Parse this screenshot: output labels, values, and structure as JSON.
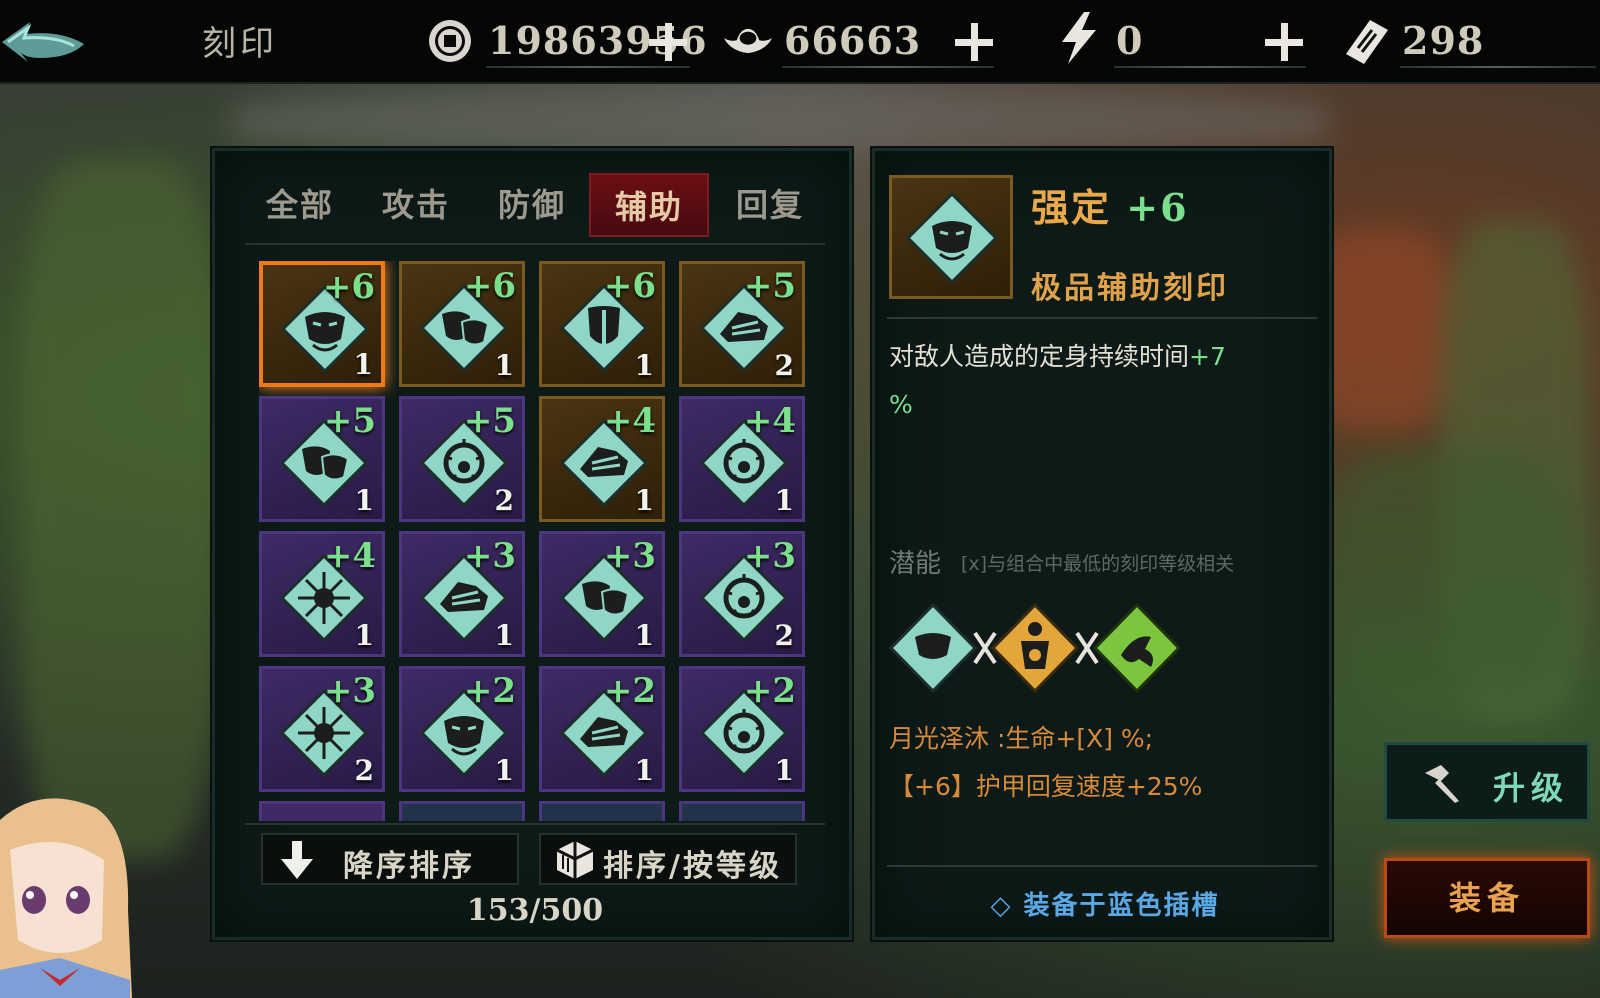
{
  "header": {
    "title": "刻印",
    "currencies": [
      {
        "icon": "copper-coin-icon",
        "value": "19863956"
      },
      {
        "icon": "silver-ingot-icon",
        "value": "66663"
      },
      {
        "icon": "lightning-energy-icon",
        "value": "0"
      },
      {
        "icon": "ticket-icon",
        "value": "298"
      }
    ]
  },
  "tabs": [
    {
      "label": "全部",
      "active": false
    },
    {
      "label": "攻击",
      "active": false
    },
    {
      "label": "防御",
      "active": false
    },
    {
      "label": "辅助",
      "active": true
    },
    {
      "label": "回复",
      "active": false
    }
  ],
  "grid": {
    "items": [
      {
        "level": "+6",
        "count": "1",
        "rarity": "gold",
        "icon": "mask-icon",
        "selected": true
      },
      {
        "level": "+6",
        "count": "1",
        "rarity": "gold",
        "icon": "theater-mask-icon"
      },
      {
        "level": "+6",
        "count": "1",
        "rarity": "gold",
        "icon": "shield-icon"
      },
      {
        "level": "+5",
        "count": "2",
        "rarity": "gold",
        "icon": "boot-icon"
      },
      {
        "level": "+5",
        "count": "1",
        "rarity": "purple",
        "icon": "theater-mask-icon"
      },
      {
        "level": "+5",
        "count": "2",
        "rarity": "purple",
        "icon": "thorn-ring-icon"
      },
      {
        "level": "+4",
        "count": "1",
        "rarity": "gold",
        "icon": "boot-icon"
      },
      {
        "level": "+4",
        "count": "1",
        "rarity": "purple",
        "icon": "thorn-ring-icon"
      },
      {
        "level": "+4",
        "count": "1",
        "rarity": "purple",
        "icon": "spark-icon"
      },
      {
        "level": "+3",
        "count": "1",
        "rarity": "purple",
        "icon": "boot-icon"
      },
      {
        "level": "+3",
        "count": "1",
        "rarity": "purple",
        "icon": "theater-mask-icon"
      },
      {
        "level": "+3",
        "count": "2",
        "rarity": "purple",
        "icon": "thorn-ring-icon"
      },
      {
        "level": "+3",
        "count": "2",
        "rarity": "purple",
        "icon": "spark-icon"
      },
      {
        "level": "+2",
        "count": "1",
        "rarity": "purple",
        "icon": "mask-icon"
      },
      {
        "level": "+2",
        "count": "1",
        "rarity": "purple",
        "icon": "boot-icon"
      },
      {
        "level": "+2",
        "count": "1",
        "rarity": "purple",
        "icon": "thorn-ring-icon"
      }
    ]
  },
  "sort": {
    "order_label": "降序排序",
    "by_label": "排序/按等级"
  },
  "inventory_count": "153/500",
  "detail": {
    "name": "强定",
    "level": "+6",
    "subtitle": "极品辅助刻印",
    "desc_text": "对敌人造成的定身持续时间",
    "desc_value": "+7",
    "desc_unit": "%",
    "potential_label": "潜能",
    "potential_note": "[x]与组合中最低的刻印等级相关",
    "combo_icons": [
      "mask-icon",
      "human-figure-icon",
      "dancer-icon"
    ],
    "bonus_line1": "月光泽沐 :生命+[X] %;",
    "bonus_line2": "【+6】护甲回复速度+25%",
    "equip_slot": "◇ 装备于蓝色插槽"
  },
  "actions": {
    "upgrade_label": "升级",
    "equip_label": "装备"
  },
  "colors": {
    "gold_cell": "#4a3412",
    "purple_cell": "#3f2a66",
    "selected_border": "#f07a1a",
    "level_green": "#7be08c",
    "title_orange": "#e9a84a",
    "equip_blue": "#5aa8e6",
    "active_tab": "#6a0f14"
  }
}
